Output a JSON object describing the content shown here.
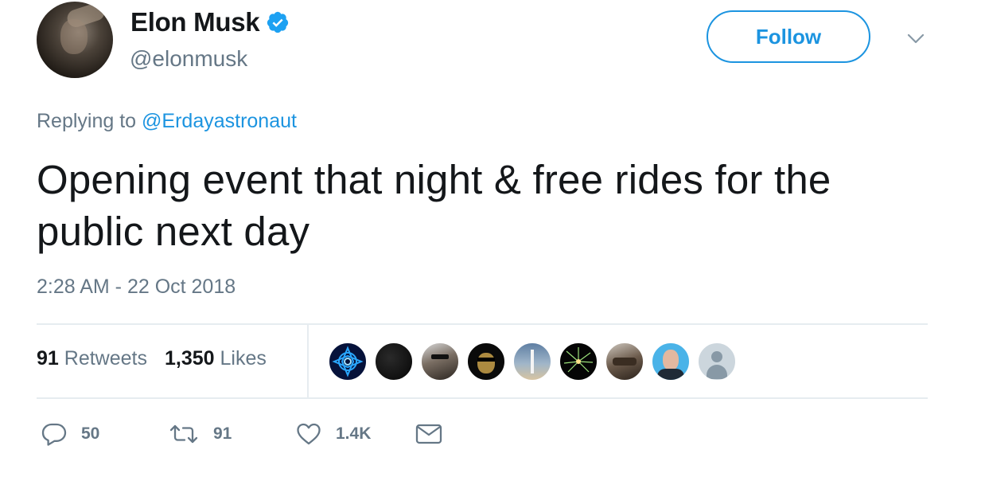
{
  "author": {
    "name": "Elon Musk",
    "handle": "@elonmusk",
    "verified_icon": "verified-badge-icon"
  },
  "header": {
    "follow_label": "Follow",
    "menu_icon": "chevron-down-icon"
  },
  "tweet": {
    "reply_prefix": "Replying to",
    "reply_mention": "@Erdayastronaut",
    "text": "Opening event that night & free rides for the public next day",
    "timestamp": "2:28 AM - 22 Oct 2018"
  },
  "stats": {
    "retweets_count": "91",
    "retweets_label": "Retweets",
    "likes_count": "1,350",
    "likes_label": "Likes"
  },
  "likers": [
    {
      "name": "liker-avatar-1"
    },
    {
      "name": "liker-avatar-2"
    },
    {
      "name": "liker-avatar-3"
    },
    {
      "name": "liker-avatar-4"
    },
    {
      "name": "liker-avatar-5"
    },
    {
      "name": "liker-avatar-6"
    },
    {
      "name": "liker-avatar-7"
    },
    {
      "name": "liker-avatar-8"
    },
    {
      "name": "liker-avatar-9"
    }
  ],
  "actions": {
    "reply_count": "50",
    "retweet_count": "91",
    "like_count": "1.4K",
    "reply_icon": "reply-icon",
    "retweet_icon": "retweet-icon",
    "like_icon": "heart-icon",
    "dm_icon": "envelope-icon"
  },
  "colors": {
    "accent": "#1c94e0",
    "muted": "#657786",
    "text": "#14171a",
    "divider": "#e6ecf0"
  }
}
